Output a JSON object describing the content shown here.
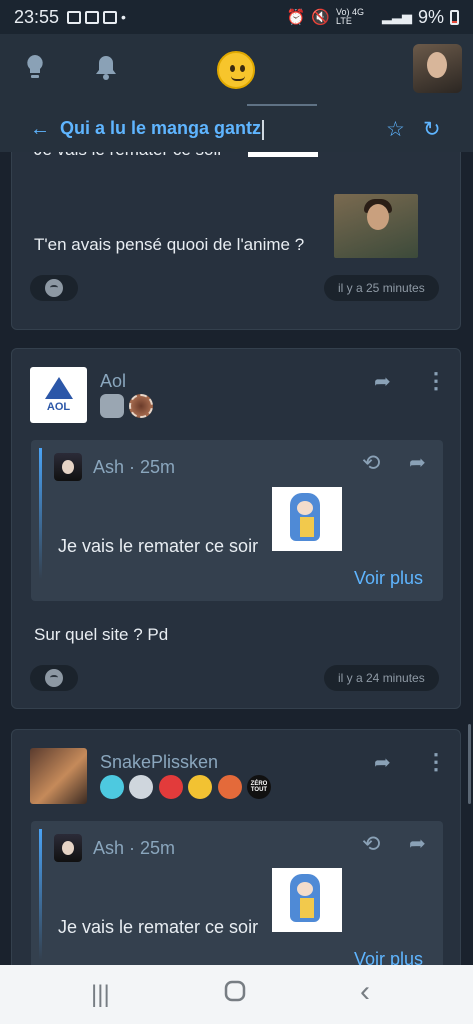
{
  "status_bar": {
    "time": "23:55",
    "signal_text": "Vo) 4G LTE",
    "battery_pct": "9%"
  },
  "app_bar": {
    "icons": [
      "lightbulb-icon",
      "bell-icon",
      "smiley-logo",
      "user-avatar"
    ]
  },
  "topic": {
    "title": "Qui a lu le manga gantz",
    "back_icon": "arrow-left-icon",
    "star_icon": "star-icon",
    "refresh_icon": "refresh-icon"
  },
  "colors": {
    "accent": "#5fb5ff",
    "background": "#1a222d",
    "card": "#27313e",
    "quote": "#34404e"
  },
  "posts": [
    {
      "partial": true,
      "quoted_text_top": "Je vais le remater ce soir",
      "text": "T'en avais pensé quooi de l'anime ?",
      "time": "il y a 25 minutes"
    },
    {
      "author": "Aol",
      "quote": {
        "author": "Ash",
        "age": "25m",
        "text": "Je vais le remater ce soir",
        "more": "Voir plus"
      },
      "text": "Sur quel site ? Pd",
      "time": "il y a 24 minutes"
    },
    {
      "author": "SnakePlissken",
      "badge_text": "ZÉRO TOUT",
      "quote": {
        "author": "Ash",
        "age": "25m",
        "text": "Je vais le remater ce soir",
        "more": "Voir plus"
      }
    }
  ],
  "nav": {
    "recents": "|||",
    "home": "○",
    "back": "‹"
  }
}
